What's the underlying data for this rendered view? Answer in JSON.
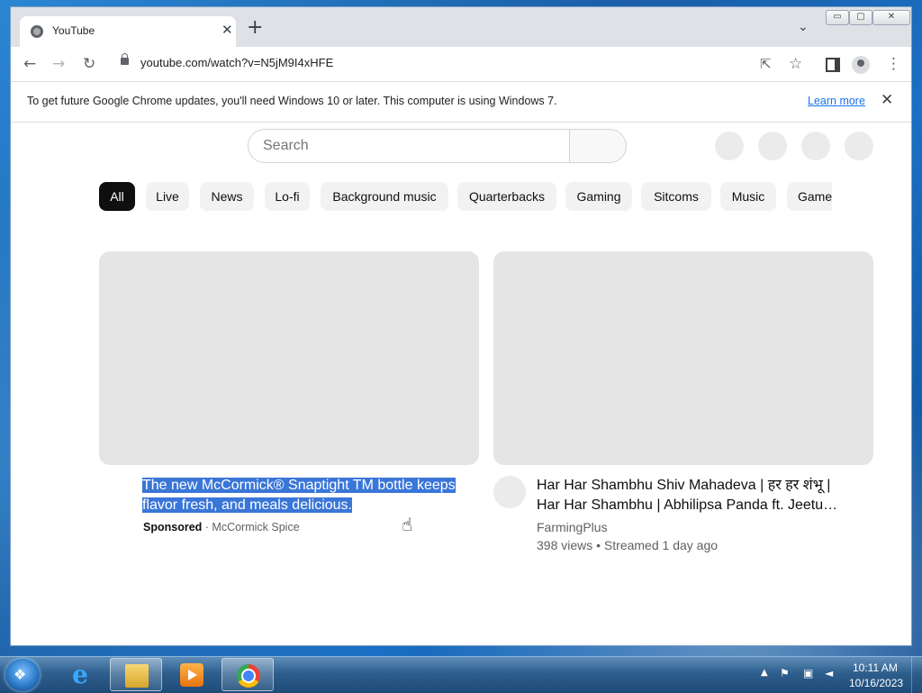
{
  "browser": {
    "tab_title": "YouTube",
    "tab_close": "✕",
    "new_tab": "+",
    "url": "youtube.com/watch?v=N5jM9I4xHFE",
    "window_buttons": {
      "minimize": "▭",
      "maximize": "▢",
      "close": "✕"
    }
  },
  "toolbar_icons": {
    "back": "←",
    "forward": "→",
    "reload": "↻",
    "share": "⇱",
    "star": "☆",
    "menu": "⋮",
    "tab_search": "⌄"
  },
  "infobar": {
    "message": "To get future Google Chrome updates, you'll need Windows 10 or later. This computer is using Windows 7.",
    "link": "Learn more",
    "close": "✕"
  },
  "youtube": {
    "search_placeholder": "Search",
    "chips": [
      "All",
      "Live",
      "News",
      "Lo-fi",
      "Background music",
      "Quarterbacks",
      "Gaming",
      "Sitcoms",
      "Music",
      "Game"
    ],
    "active_chip": "All",
    "videos": [
      {
        "title": "The new McCormick® Snaptight TM bottle keeps flavor fresh, and meals delicious.",
        "sponsored": "Sponsored",
        "separator": " · ",
        "channel": "McCormick Spice"
      },
      {
        "title": "Har Har Shambhu Shiv Mahadeva | हर हर शंभू | Har Har Shambhu | Abhilipsa Panda ft. Jeetu…",
        "channel": "FarmingPlus",
        "stats": "398 views • Streamed 1 day ago"
      }
    ]
  },
  "taskbar": {
    "clock_time": "10:11 AM",
    "clock_date": "10/16/2023",
    "tray_up": "▲"
  },
  "colors": {
    "selection": "#3a76d8",
    "link": "#1a73e8",
    "active_chip": "#0f0f0f"
  }
}
